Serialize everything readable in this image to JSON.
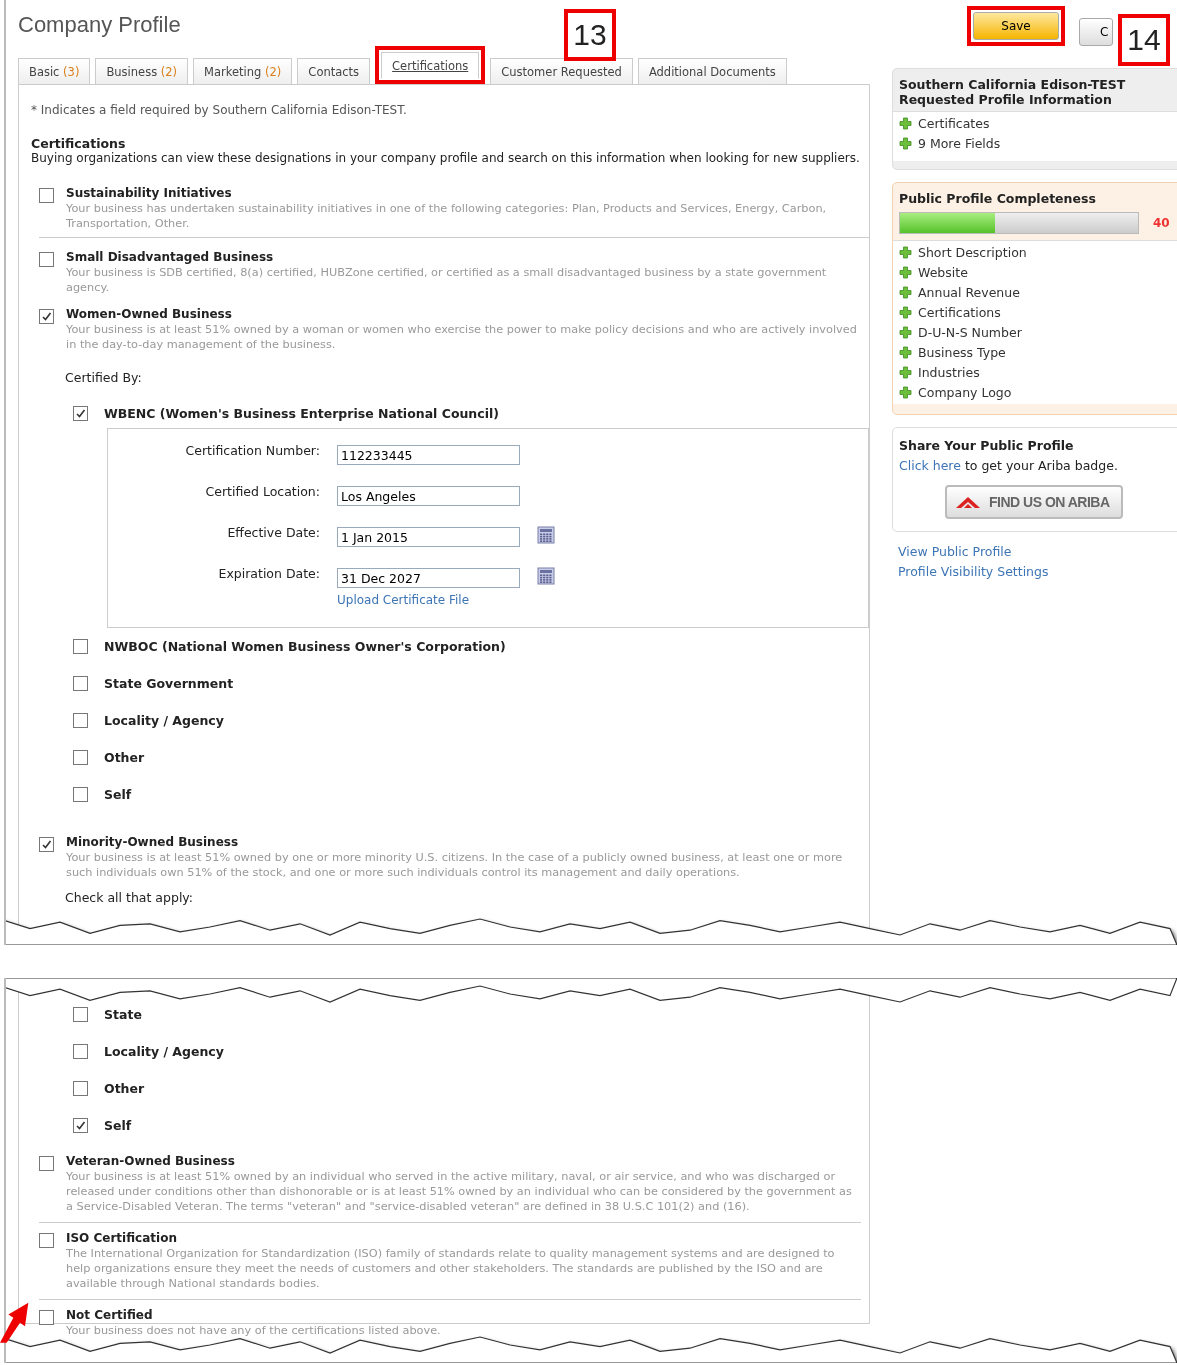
{
  "page": {
    "title": "Company Profile"
  },
  "tabs": [
    {
      "label": "Basic",
      "count": "(3)",
      "selected": false,
      "highlighted": false
    },
    {
      "label": "Business",
      "count": "(2)",
      "selected": false,
      "highlighted": false
    },
    {
      "label": "Marketing",
      "count": "(2)",
      "selected": false,
      "highlighted": false
    },
    {
      "label": "Contacts",
      "selected": false,
      "highlighted": false
    },
    {
      "label": "Certifications",
      "selected": true,
      "highlighted": true
    },
    {
      "label": "Customer Requested",
      "selected": false,
      "highlighted": false
    },
    {
      "label": "Additional Documents",
      "selected": false,
      "highlighted": false
    }
  ],
  "actions": [
    {
      "label": "Save",
      "kind": "primary",
      "highlighted": true
    },
    {
      "label": "C",
      "kind": "secondary",
      "highlighted": false
    }
  ],
  "callouts": [
    {
      "label": "13"
    },
    {
      "label": "14"
    }
  ],
  "form_top": {
    "required_note": "* Indicates a field required by Southern California Edison-TEST.",
    "heading": "Certifications",
    "intro": "Buying organizations can view these designations in your company profile and search on this information when looking for new suppliers.",
    "items": [
      {
        "label": "Sustainability Initiatives",
        "description": "Your business has undertaken sustainability initiatives in one of the following categories: Plan, Products and Services, Energy, Carbon, Transportation, Other.",
        "checked": false,
        "separated": true
      },
      {
        "label": "Small Disadvantaged Business",
        "description": "Your business is SDB certified, 8(a) certified, HUBZone certified, or certified as a small disadvantaged business by a state government agency.",
        "checked": false,
        "separated": false
      },
      {
        "label": "Women-Owned Business",
        "description": "Your business is at least 51% owned by a woman or women who exercise the power to make policy decisions and who are actively involved in the day-to-day management of the business.",
        "checked": true,
        "separated": false,
        "certified_by": {
          "label": "Certified By:",
          "options": [
            {
              "label": "WBENC (Women's Business Enterprise National Council)",
              "checked": true,
              "fields": [
                {
                  "label": "Certification Number:",
                  "value": "112233445",
                  "kind": "text"
                },
                {
                  "label": "Certified Location:",
                  "value": "Los Angeles",
                  "kind": "text"
                },
                {
                  "label": "Effective Date:",
                  "value": "1 Jan 2015",
                  "kind": "date"
                },
                {
                  "label": "Expiration Date:",
                  "value": "31 Dec 2027",
                  "kind": "date"
                }
              ],
              "upload_link": "Upload Certificate File"
            },
            {
              "label": "NWBOC (National Women Business Owner's Corporation)",
              "checked": false
            },
            {
              "label": "State Government",
              "checked": false
            },
            {
              "label": "Locality / Agency",
              "checked": false
            },
            {
              "label": "Other",
              "checked": false
            },
            {
              "label": "Self",
              "checked": false
            }
          ]
        }
      },
      {
        "label": "Minority-Owned Business",
        "description": "Your business is at least 51% owned by one or more minority U.S. citizens. In the case of a publicly owned business, at least one or more such individuals own 51% of the stock, and one or more such individuals control its management and daily operations.",
        "checked": true,
        "separated": false,
        "apply_label": "Check all that apply:"
      }
    ]
  },
  "form_bottom": {
    "options": [
      {
        "label": "State",
        "checked": false
      },
      {
        "label": "Locality / Agency",
        "checked": false
      },
      {
        "label": "Other",
        "checked": false
      },
      {
        "label": "Self",
        "checked": true
      }
    ],
    "items": [
      {
        "label": "Veteran-Owned Business",
        "description": "Your business is at least 51% owned by an individual who served in the active military, naval, or air service, and who was discharged or released under conditions other than dishonorable or is at least 51% owned by an individual who can be considered by the government as a Service-Disabled Veteran. The terms \"veteran\" and \"service-disabled veteran\" are defined in 38 U.S.C 101(2) and (16).",
        "checked": false,
        "separated": true
      },
      {
        "label": "ISO Certification",
        "description": "The International Organization for Standardization (ISO) family of standards relate to quality management systems and are designed to help organizations ensure they meet the needs of customers and other stakeholders. The standards are published by the ISO and are available through National standards bodies.",
        "checked": false,
        "separated": true
      },
      {
        "label": "Not Certified",
        "description": "Your business does not have any of the certifications listed above.",
        "checked": false,
        "separated": false
      }
    ]
  },
  "sidebar": {
    "requested": {
      "title_lines": [
        "Southern California Edison-TEST",
        "Requested Profile Information"
      ],
      "items": [
        "Certificates",
        "9 More Fields"
      ]
    },
    "completeness": {
      "title": "Public Profile Completeness",
      "level": 0.4,
      "percent": "40",
      "items": [
        "Short Description",
        "Website",
        "Annual Revenue",
        "Certifications",
        "D-U-N-S Number",
        "Business Type",
        "Industries",
        "Company Logo"
      ]
    },
    "share": {
      "title": "Share Your Public Profile",
      "link": "Click here",
      "text": " to get your Ariba badge.",
      "badge": "FIND US ON ARIBA"
    },
    "links": [
      "View Public Profile",
      "Profile Visibility Settings"
    ]
  }
}
